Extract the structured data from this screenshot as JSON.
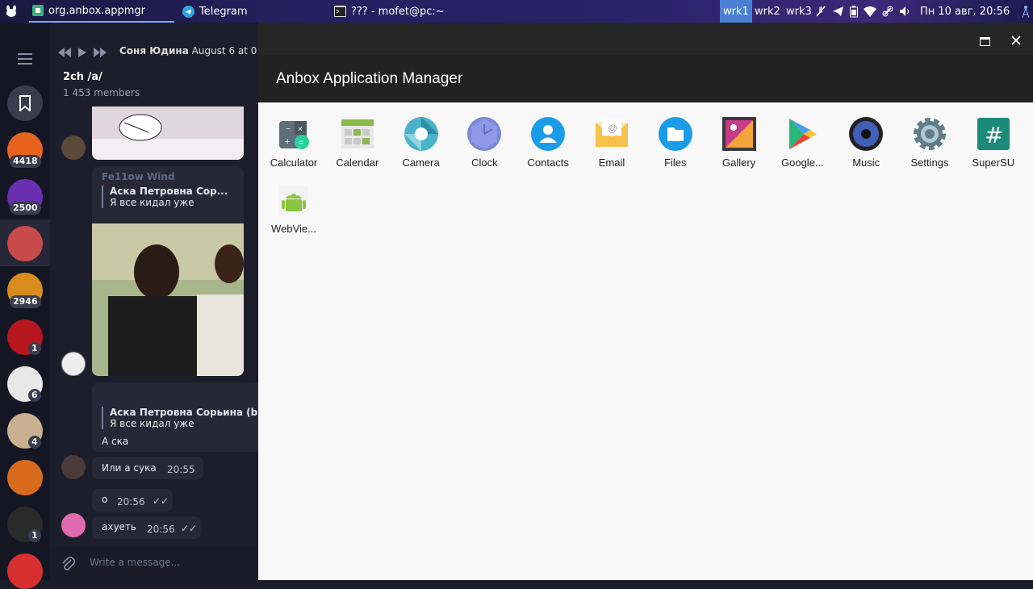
{
  "taskbar": {
    "windows": [
      {
        "label": "org.anbox.appmgr",
        "active": true
      },
      {
        "label": "Telegram",
        "active": false
      },
      {
        "label": "??? - mofet@pc:~",
        "active": false
      }
    ],
    "workspaces": [
      {
        "label": "wrk1",
        "active": true
      },
      {
        "label": "wrk2",
        "active": false
      },
      {
        "label": "wrk3",
        "active": false
      }
    ],
    "clock": "Пн 10 авг, 20:56"
  },
  "telegram": {
    "header": {
      "sender": "Соня Юдина",
      "sender_time": "August 6 at 0",
      "chat_title": "2ch /a/",
      "members": "1 453 members"
    },
    "chat_list": [
      {
        "badge": "4418",
        "color": "#e8641e"
      },
      {
        "badge": "2500",
        "color": "#6a2fb0"
      },
      {
        "badge": "",
        "color": "#c94a4a"
      },
      {
        "badge": "2946",
        "color": "#d98c1e"
      },
      {
        "badge": "1",
        "color": "#b8161e"
      },
      {
        "badge": "6",
        "color": "#e8e8e8"
      },
      {
        "badge": "4",
        "color": "#c8b090"
      },
      {
        "badge": "",
        "color": "#d86a1e"
      },
      {
        "badge": "1",
        "color": "#2a2a2a"
      },
      {
        "badge": "",
        "color": "#d83030"
      }
    ],
    "messages": {
      "reply1_author": "Fe11ow Wind",
      "reply1_quote_name": "Аска Петровна Сор...",
      "reply1_quote_text": "Я все кидал уже",
      "reply2_quote_name": "Аска Петровна Сорьина (b",
      "reply2_quote_text": "Я все кидал уже",
      "reply2_text": "А ска",
      "m3_text": "Или а сука",
      "m3_time": "20:55",
      "m4_text": "о",
      "m4_time": "20:56",
      "m5_text": "ахуеть",
      "m5_time": "20:56"
    },
    "composer_placeholder": "Write a message..."
  },
  "anbox": {
    "title": "Anbox Application Manager",
    "apps": [
      {
        "label": "Calculator",
        "icon": "calculator-icon"
      },
      {
        "label": "Calendar",
        "icon": "calendar-icon"
      },
      {
        "label": "Camera",
        "icon": "camera-icon"
      },
      {
        "label": "Clock",
        "icon": "clock-icon"
      },
      {
        "label": "Contacts",
        "icon": "contacts-icon"
      },
      {
        "label": "Email",
        "icon": "email-icon"
      },
      {
        "label": "Files",
        "icon": "files-icon"
      },
      {
        "label": "Gallery",
        "icon": "gallery-icon"
      },
      {
        "label": "Google...",
        "icon": "play-store-icon"
      },
      {
        "label": "Music",
        "icon": "music-icon"
      },
      {
        "label": "Settings",
        "icon": "settings-icon"
      },
      {
        "label": "SuperSU",
        "icon": "supersu-icon"
      },
      {
        "label": "WebVie...",
        "icon": "android-icon"
      }
    ]
  }
}
